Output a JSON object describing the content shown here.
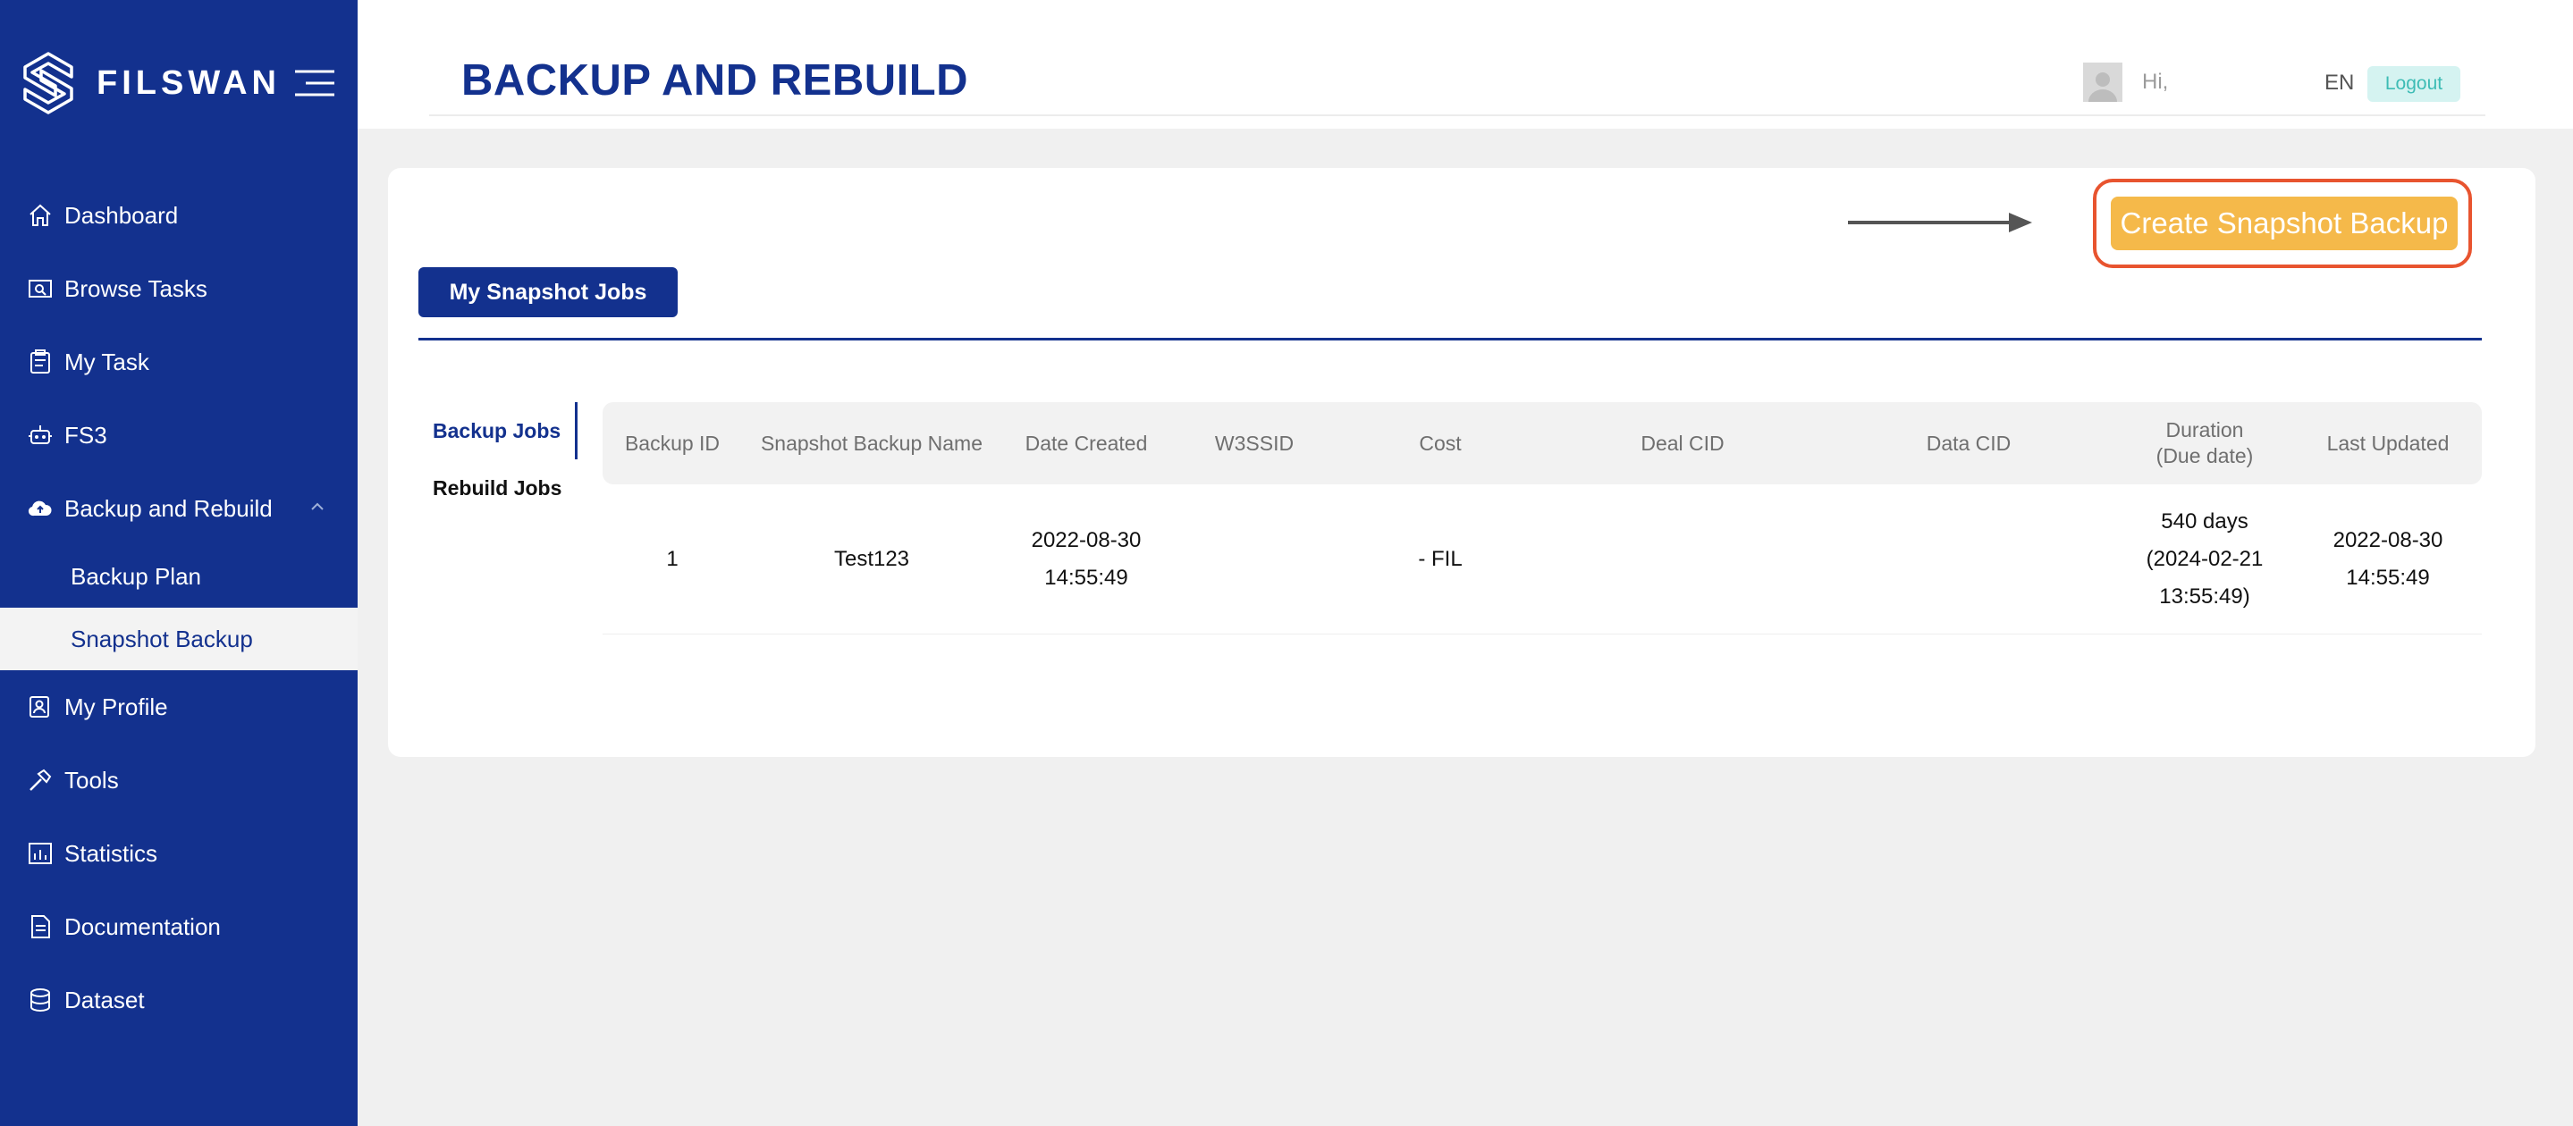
{
  "brand": {
    "name": "FILSWAN"
  },
  "sidebar": {
    "items": [
      {
        "label": "Dashboard",
        "icon": "home-icon"
      },
      {
        "label": "Browse Tasks",
        "icon": "browse-icon"
      },
      {
        "label": "My Task",
        "icon": "clipboard-icon"
      },
      {
        "label": "FS3",
        "icon": "robot-icon"
      },
      {
        "label": "Backup and Rebuild",
        "icon": "cloud-upload-icon",
        "expanded": true,
        "children": [
          {
            "label": "Backup Plan"
          },
          {
            "label": "Snapshot Backup",
            "active": true
          }
        ]
      },
      {
        "label": "My Profile",
        "icon": "profile-icon"
      },
      {
        "label": "Tools",
        "icon": "hammer-icon"
      },
      {
        "label": "Statistics",
        "icon": "chart-icon"
      },
      {
        "label": "Documentation",
        "icon": "document-icon"
      },
      {
        "label": "Dataset",
        "icon": "database-icon"
      }
    ]
  },
  "header": {
    "title": "BACKUP AND REBUILD",
    "greeting": "Hi,",
    "language": "EN",
    "logout_label": "Logout"
  },
  "main": {
    "create_button_label": "Create Snapshot Backup",
    "tab_label": "My Snapshot Jobs",
    "sub_tabs": [
      {
        "label": "Backup Jobs",
        "active": true
      },
      {
        "label": "Rebuild Jobs",
        "active": false
      }
    ],
    "table": {
      "headers": {
        "backup_id": "Backup ID",
        "name": "Snapshot Backup Name",
        "date_created": "Date Created",
        "w3ssid": "W3SSID",
        "cost": "Cost",
        "deal_cid": "Deal CID",
        "data_cid": "Data CID",
        "duration_line1": "Duration",
        "duration_line2": "(Due date)",
        "last_updated": "Last Updated"
      },
      "rows": [
        {
          "backup_id": "1",
          "name": "Test123",
          "date_created_date": "2022-08-30",
          "date_created_time": "14:55:49",
          "w3ssid": "",
          "cost": "- FIL",
          "deal_cid": "",
          "data_cid": "",
          "duration_days": "540 days",
          "duration_due_date": "(2024-02-21",
          "duration_due_time": "13:55:49)",
          "last_updated_date": "2022-08-30",
          "last_updated_time": "14:55:49"
        }
      ]
    }
  },
  "colors": {
    "sidebar_bg": "#13318e",
    "accent": "#13318e",
    "create_button": "#f5b94a",
    "highlight_border": "#e8542f",
    "logout_bg": "#d5f3f1",
    "logout_text": "#3dbcb5"
  }
}
